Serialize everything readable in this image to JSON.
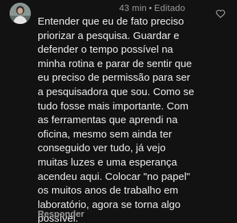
{
  "comment": {
    "time": "43 min",
    "separator": "•",
    "edited_label": "Editado",
    "lines": [
      "Entender que eu de fato preciso",
      "priorizar a pesquisa. Guardar e",
      "defender o tempo possível na",
      "minha rotina e parar de sentir que",
      "eu preciso de permissão para ser",
      "a pesquisadora que sou. Como se",
      "tudo fosse mais importante. Com",
      "as ferramentas que aprendi na",
      "oficina, mesmo sem ainda ter",
      "conseguido ver tudo, já vejo",
      "muitas luzes e uma esperança",
      "acendeu aqui. Colocar \"no papel\"",
      "os muitos anos de trabalho em",
      "laboratório, agora se torna algo",
      "possível."
    ],
    "reply_label": "Responder",
    "like_icon": "heart-outline-icon"
  },
  "colors": {
    "background": "#121212",
    "text": "#ededed",
    "muted": "#9a9a9a"
  }
}
